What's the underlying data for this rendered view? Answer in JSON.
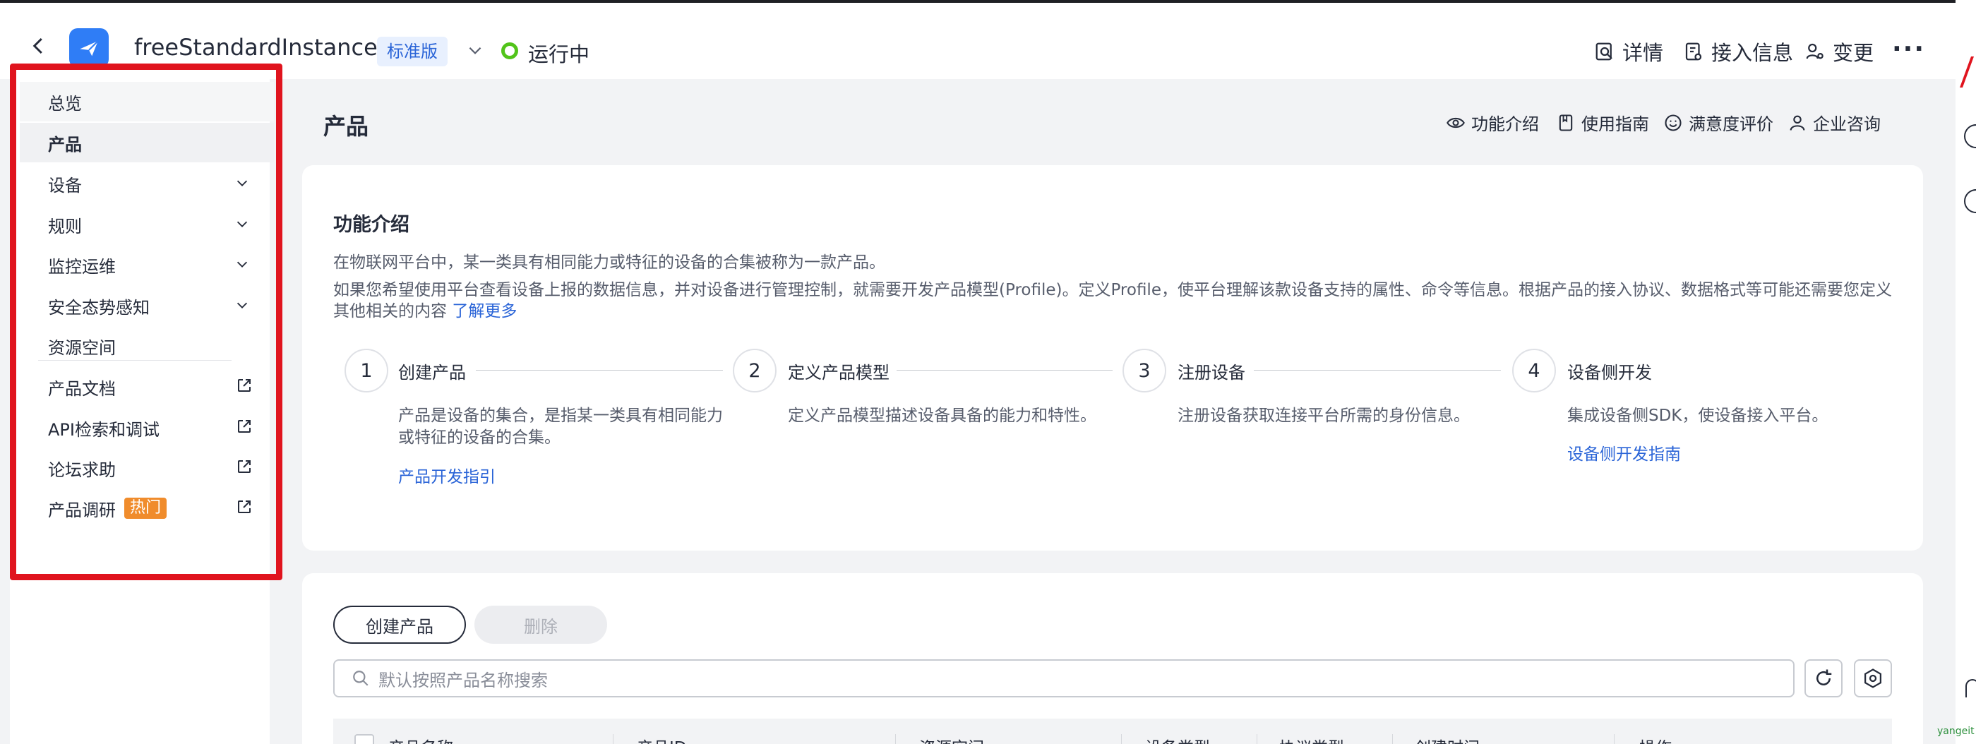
{
  "header": {
    "instance_name": "freeStandardInstance",
    "edition_badge": "标准版",
    "status": "运行中",
    "actions": {
      "details": "详情",
      "access_info": "接入信息",
      "change": "变更"
    },
    "more": "···"
  },
  "sidebar": {
    "items": [
      {
        "label": "总览"
      },
      {
        "label": "产品"
      },
      {
        "label": "设备"
      },
      {
        "label": "规则"
      },
      {
        "label": "监控运维"
      },
      {
        "label": "安全态势感知"
      },
      {
        "label": "资源空间"
      },
      {
        "label": "产品文档"
      },
      {
        "label": "API检索和调试"
      },
      {
        "label": "论坛求助"
      },
      {
        "label": "产品调研"
      }
    ],
    "hot_badge": "热门"
  },
  "main": {
    "title": "产品",
    "top_actions": {
      "intro": "功能介绍",
      "guide": "使用指南",
      "feedback": "满意度评价",
      "consult": "企业咨询"
    },
    "intro_card": {
      "title": "功能介绍",
      "desc1": "在物联网平台中，某一类具有相同能力或特征的设备的合集被称为一款产品。",
      "desc2": "如果您希望使用平台查看设备上报的数据信息，并对设备进行管理控制，就需要开发产品模型(Profile)。定义Profile，使平台理解该款设备支持的属性、命令等信息。根据产品的接入协议、数据格式等可能还需要您定义其他相关的内容",
      "learn_more": "了解更多",
      "steps": [
        {
          "num": "1",
          "title": "创建产品",
          "desc": "产品是设备的集合，是指某一类具有相同能力或特征的设备的合集。",
          "link": "产品开发指引"
        },
        {
          "num": "2",
          "title": "定义产品模型",
          "desc": "定义产品模型描述设备具备的能力和特性。",
          "link": ""
        },
        {
          "num": "3",
          "title": "注册设备",
          "desc": "注册设备获取连接平台所需的身份信息。",
          "link": ""
        },
        {
          "num": "4",
          "title": "设备侧开发",
          "desc": "集成设备侧SDK，使设备接入平台。",
          "link": "设备侧开发指南"
        }
      ]
    },
    "list": {
      "create_button": "创建产品",
      "delete_button": "删除",
      "search_placeholder": "默认按照产品名称搜索",
      "columns": [
        "产品名称",
        "产品ID",
        "资源空间",
        "设备类型",
        "协议类型",
        "创建时间",
        "操作"
      ]
    }
  },
  "watermark": "yangeit",
  "colors": {
    "accent": "#2a64d7",
    "status_ok": "#52c41a",
    "highlight_box": "#e0141e",
    "hot_badge": "#f08c2c"
  }
}
